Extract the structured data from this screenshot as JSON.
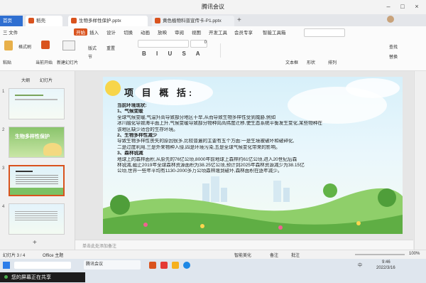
{
  "window": {
    "title": "腾讯会议"
  },
  "tabs": [
    {
      "label": "首页",
      "active": false,
      "color": "#2f6fd1"
    },
    {
      "label": "稻壳",
      "active": false,
      "color": "#d9531e"
    },
    {
      "label": "生物多样性保护.pptx",
      "active": true,
      "color": "#d9531e"
    },
    {
      "label": "黄色植物科普宣传卡-P1.pptx",
      "active": false,
      "color": "#d9531e"
    }
  ],
  "menu": [
    "三 文件",
    "开始",
    "插入",
    "设计",
    "切换",
    "动画",
    "放映",
    "审阅",
    "视图",
    "开发工具",
    "会员专享",
    "智能工具箱"
  ],
  "ribbon": {
    "groups": [
      "格式刷",
      "粘贴",
      "当前开始",
      "新建幻灯片",
      "版式",
      "节",
      "重置",
      "文本框",
      "形状",
      "排列",
      "查找",
      "替换"
    ],
    "font_name": "",
    "font_size": "0"
  },
  "left_panel": {
    "tabs": [
      "大纲",
      "幻灯片"
    ],
    "slide_numbers": [
      "1",
      "2",
      "3",
      "4"
    ],
    "thumb2_title": "生物多样性保护"
  },
  "slide": {
    "title": "项 目 概 括:",
    "lines": [
      "当前环境现状:",
      "1、气候变暖",
      "全球气候变暖,气温升高导致部分地区干旱,从而导致生物多样性受到威胁,例如",
      "冰川融化导致海平面上升,气候变暖导致部分物种向高纬度迁移,使生态系统平衡发生变化,某些物种在",
      "该地区缺少适合的生存环境。",
      "2、生物多样性减少",
      "导致生物多样性丧失的原因很多,比较普遍的主要有五个方面:一是生境被破坏和破碎化,",
      "二是过度利用,三是外来物种入侵,四是环境污染,五是全球气候变化带来的影响。",
      "3、森林锐减",
      "地球上的森林面积,从原先的76亿公顷,8000年前地球上森林约61亿公顷,进入20世纪后森",
      "林锐减,截止2019年全球森林资源面积为38.25亿公顷,预计到2025年森林资源减少为38.15亿",
      "公顷,世界一些年平均有1130-2000多万公顷森林遭到破坏,森林面积在逐年减少。"
    ]
  },
  "notes": {
    "placeholder": "单击此处添加备注"
  },
  "status": {
    "slide_info": "幻灯片 3 / 4",
    "theme": "Office 主题",
    "zoom": "100%",
    "smart": "智能美化",
    "notes_btn": "备注",
    "comment_btn": "批注"
  },
  "taskbar": {
    "meeting_text": "您的屏幕正在共享",
    "time": "9:46",
    "date": "2022/3/16",
    "lang": "中",
    "items": [
      "腾讯会议",
      "生物多样性保护"
    ]
  }
}
